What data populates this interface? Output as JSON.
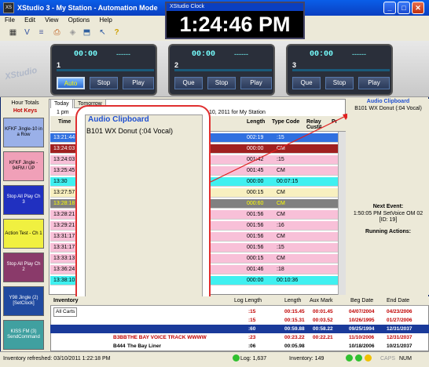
{
  "window": {
    "title": "XStudio 3 - My Station - Automation Mode"
  },
  "menu": [
    "File",
    "Edit",
    "View",
    "Options",
    "Help"
  ],
  "clock": {
    "title": "XStudio Clock",
    "time": "1:24:46 PM"
  },
  "logo": "XStudio",
  "decks": [
    {
      "num": "1",
      "time": "00:00",
      "dash": "------",
      "buttons": [
        "Auto",
        "Stop",
        "Play"
      ],
      "active": 0
    },
    {
      "num": "2",
      "time": "00:00",
      "dash": "------",
      "buttons": [
        "Que",
        "Stop",
        "Play"
      ],
      "active": -1
    },
    {
      "num": "3",
      "time": "00:00",
      "dash": "------",
      "buttons": [
        "Que",
        "Stop",
        "Play"
      ],
      "active": -1
    }
  ],
  "left": {
    "hour_totals": "Hour Totals",
    "hot_keys": "Hot Keys",
    "keys": [
      {
        "label": "KFKF Jingle-10 in a Row",
        "bg": "#9ab0e8",
        "fg": "#000"
      },
      {
        "label": "KFKF Jingle - 94FM / UP",
        "bg": "#f0a0b8",
        "fg": "#000"
      },
      {
        "label": "Stop All Play Ch 3",
        "bg": "#2030c0",
        "fg": "#fff"
      },
      {
        "label": "Action Test - Ch 1",
        "bg": "#f0f040",
        "fg": "#000"
      },
      {
        "label": "Stop All Play Ch 2",
        "bg": "#8a3a6a",
        "fg": "#fff"
      },
      {
        "label": "Y98 Jingle (2) [SetClock]",
        "bg": "#204aa0",
        "fg": "#fff"
      },
      {
        "label": "KISS FM (3) SendCommand",
        "bg": "#40a0a0",
        "fg": "#fff"
      }
    ]
  },
  "tabs": [
    "Today",
    "Tomorrow"
  ],
  "grid": {
    "hour_label": "1 pm",
    "date_text": "10, 2011 for My Station",
    "headers": [
      "Time",
      "Length",
      "Type Code",
      "Relay Cust#",
      "Pr"
    ],
    "rows": [
      {
        "time": "13:21:44",
        "len": "002:19",
        "type": ":15",
        "bg": "#3070e0",
        "fg": "#fff"
      },
      {
        "time": "13:24:03",
        "len": "000:00",
        "type": "CM",
        "bg": "#a02020",
        "fg": "#fff"
      },
      {
        "time": "13:24:03",
        "len": "001:42",
        "type": ":15",
        "bg": "#f8c0d8",
        "fg": "#000"
      },
      {
        "time": "13:25:45",
        "len": "001:45",
        "type": "CM",
        "bg": "#f8c0d8",
        "fg": "#000"
      },
      {
        "time": "13:30",
        "len": "000:00",
        "type": "00:07:15",
        "bg": "#40f0f0",
        "fg": "#000"
      },
      {
        "time": "13:27:57",
        "len": "000:15",
        "type": "CM",
        "bg": "#f8f0c0",
        "fg": "#000"
      },
      {
        "time": "13:28:18",
        "len": "000:60",
        "type": "CM",
        "bg": "#808080",
        "fg": "#ff0"
      },
      {
        "time": "13:28:21",
        "len": "001:56",
        "type": "CM",
        "bg": "#f8c0d8",
        "fg": "#000"
      },
      {
        "time": "13:29:21",
        "len": "001:56",
        "type": ":16",
        "bg": "#f8c0d8",
        "fg": "#000"
      },
      {
        "time": "13:31:17",
        "len": "001:56",
        "type": "CM",
        "bg": "#f8c0d8",
        "fg": "#000"
      },
      {
        "time": "13:31:17",
        "len": "001:56",
        "type": ":15",
        "bg": "#f8c0d8",
        "fg": "#000"
      },
      {
        "time": "13:33:13",
        "len": "000:15",
        "type": "CM",
        "bg": "#f8c0d8",
        "fg": "#000"
      },
      {
        "time": "13:36:24",
        "len": "001:46",
        "type": ":18",
        "bg": "#f8c0d8",
        "fg": "#000"
      },
      {
        "time": "13:38:10",
        "len": "000:00",
        "type": "00:10:36",
        "bg": "#40f0f0",
        "fg": "#000"
      }
    ]
  },
  "clipboard": {
    "title": "Audio Clipboard",
    "value": "B101 WX Donut (:04 Vocal)"
  },
  "rightpane": {
    "title": "Audio Clipboard",
    "value": "B101 WX Donut (:04 Vocal)",
    "next_event_label": "Next Event:",
    "next_event": "1:50:05 PM SetVoice OM 02",
    "next_event_id": "[ID: 19]",
    "running_label": "Running Actions:"
  },
  "inventory": {
    "tab": "Inventory",
    "filter": "All Carts",
    "headers": [
      "Log Length",
      "Length",
      "Aux Mark",
      "Beg Date",
      "End Date"
    ],
    "rows": [
      {
        "cart": "",
        "title": "",
        "log": ":15",
        "len": "00:15.45",
        "aux": "00:01.45",
        "beg": "04/07/2004",
        "end": "04/23/2006",
        "fg": "#c00000"
      },
      {
        "cart": "",
        "title": "",
        "log": ":15",
        "len": "00:15.31",
        "aux": "00:03.52",
        "beg": "10/26/1995",
        "end": "01/27/2006",
        "fg": "#c00000"
      },
      {
        "cart": "",
        "title": "",
        "log": ":60",
        "len": "00:59.88",
        "aux": "00:58.22",
        "beg": "09/25/1994",
        "end": "12/31/2037",
        "fg": "#fff"
      },
      {
        "cart": "B3BB",
        "title": "THE BAY VOICE TRACK WWWW",
        "log": ":23",
        "len": "00:23.22",
        "aux": "00:22.21",
        "beg": "11/10/2006",
        "end": "12/31/2037",
        "fg": "#c00000"
      },
      {
        "cart": "B444",
        "title": "The Bay Liner",
        "log": ":06",
        "len": "00:05.98",
        "aux": "",
        "beg": "10/18/2006",
        "end": "10/21/2037",
        "fg": "#000"
      }
    ]
  },
  "status": {
    "refreshed": "Inventory refreshed: 03/10/2011 1:22:18 PM",
    "log": "Log: 1,637",
    "inventory": "Inventory: 149",
    "caps": "CAPS",
    "num": "NUM"
  }
}
